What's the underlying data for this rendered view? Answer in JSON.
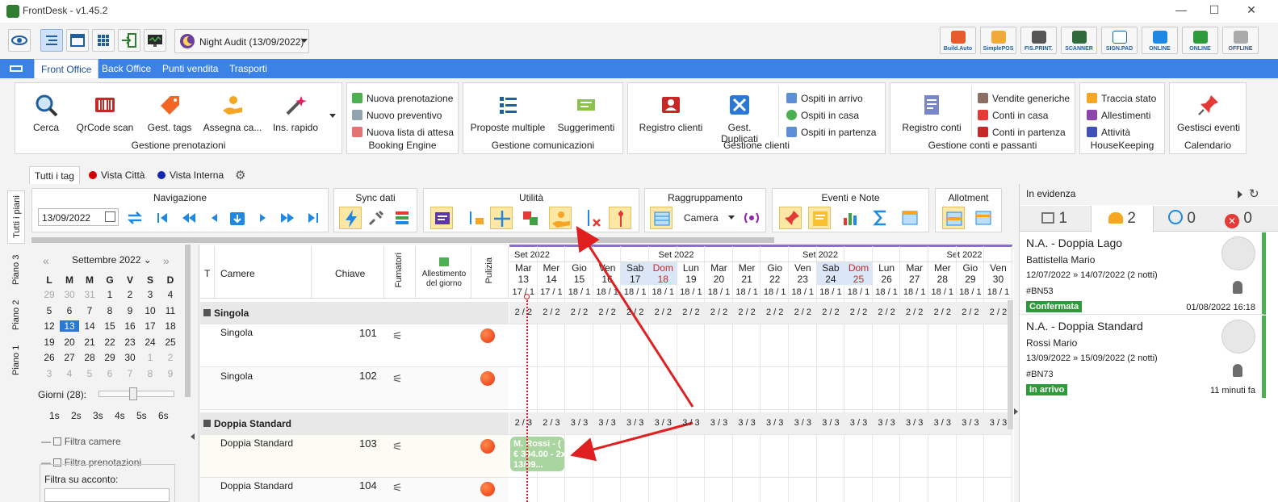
{
  "window": {
    "title": "FrontDesk - v1.45.2"
  },
  "toolbar": {
    "night_audit": "Night Audit (13/09/2022)",
    "right_buttons": [
      "Build.Auto",
      "SimplePOS",
      "FIS.PRINT.",
      "SCANNER",
      "SIGN.PAD",
      "ONLINE",
      "ONLINE",
      "OFFLINE"
    ]
  },
  "menu": [
    "Front Office",
    "Back Office",
    "Punti vendita",
    "Trasporti"
  ],
  "ribbon": {
    "gestione_prenotazioni": {
      "title": "Gestione prenotazioni",
      "buttons": [
        "Cerca",
        "QrCode scan",
        "Gest. tags",
        "Assegna ca...",
        "Ins. rapido"
      ]
    },
    "booking_engine": {
      "title": "Booking Engine",
      "buttons": [
        "Nuova prenotazione",
        "Nuovo preventivo",
        "Nuova lista di attesa"
      ]
    },
    "gestione_comunicazioni": {
      "title": "Gestione comunicazioni",
      "buttons": [
        "Proposte multiple",
        "Suggerimenti"
      ]
    },
    "gestione_clienti": {
      "title": "Gestione clienti",
      "buttons": [
        "Registro clienti",
        "Gest. Duplicati"
      ],
      "small": [
        "Ospiti in arrivo",
        "Ospiti in casa",
        "Ospiti in partenza"
      ]
    },
    "gestione_conti": {
      "title": "Gestione conti e passanti",
      "buttons": [
        "Registro conti"
      ],
      "small": [
        "Vendite generiche",
        "Conti in casa",
        "Conti in partenza"
      ]
    },
    "housekeeping": {
      "title": "HouseKeeping",
      "small": [
        "Traccia stato",
        "Allestimenti",
        "Attività"
      ]
    },
    "calendario": {
      "title": "Calendario",
      "buttons": [
        "Gestisci eventi"
      ]
    }
  },
  "view_tabs": [
    "Tutti i tag",
    "Vista Città",
    "Vista Interna"
  ],
  "floor_tabs": [
    "Tutti i piani",
    "Piano 3",
    "Piano 2",
    "Piano 1"
  ],
  "nav": {
    "navigazione": "Navigazione",
    "date": "13/09/2022",
    "sync": "Sync dati",
    "utilita": "Utilità",
    "raggruppamento": "Raggruppamento",
    "raggruppamento_value": "Camera",
    "eventi": "Eventi e Note",
    "allotment": "Allotment"
  },
  "calendar": {
    "month": "Settembre 2022",
    "weekdays": [
      "L",
      "M",
      "M",
      "G",
      "V",
      "S",
      "D"
    ],
    "weeks": [
      [
        "29",
        "30",
        "31",
        "1",
        "2",
        "3",
        "4"
      ],
      [
        "5",
        "6",
        "7",
        "8",
        "9",
        "10",
        "11"
      ],
      [
        "12",
        "13",
        "14",
        "15",
        "16",
        "17",
        "18"
      ],
      [
        "19",
        "20",
        "21",
        "22",
        "23",
        "24",
        "25"
      ],
      [
        "26",
        "27",
        "28",
        "29",
        "30",
        "1",
        "2"
      ],
      [
        "3",
        "4",
        "5",
        "6",
        "7",
        "8",
        "9"
      ]
    ],
    "selected": "13",
    "days_label": "Giorni (28):",
    "presets": [
      "1s",
      "2s",
      "3s",
      "4s",
      "5s",
      "6s"
    ],
    "filtra_camere": "Filtra camere",
    "filtra_prenotazioni": "Filtra prenotazioni",
    "filtra_acconto": "Filtra su acconto:"
  },
  "grid": {
    "headers": {
      "t": "T",
      "camere": "Camere",
      "chiave": "Chiave",
      "fumatori": "Fumatori",
      "allestimento": "Allestimento del giorno",
      "pulizia": "Pulizia"
    },
    "months": [
      "Set 2022",
      "Set 2022",
      "Set 2022",
      "Set 2022"
    ],
    "days": [
      {
        "d": "Mar",
        "n": "13",
        "o": "17 / 1",
        "g1": "2 / 2",
        "g2": "2 / 3"
      },
      {
        "d": "Mer",
        "n": "14",
        "o": "17 / 1",
        "g1": "2 / 2",
        "g2": "2 / 3"
      },
      {
        "d": "Gio",
        "n": "15",
        "o": "18 / 1",
        "g1": "2 / 2",
        "g2": "3 / 3"
      },
      {
        "d": "Ven",
        "n": "16",
        "o": "18 / 1",
        "g1": "2 / 2",
        "g2": "3 / 3"
      },
      {
        "d": "Sab",
        "n": "17",
        "o": "18 / 1",
        "g1": "2 / 2",
        "g2": "3 / 3"
      },
      {
        "d": "Dom",
        "n": "18",
        "o": "18 / 1",
        "g1": "2 / 2",
        "g2": "3 / 3"
      },
      {
        "d": "Lun",
        "n": "19",
        "o": "18 / 1",
        "g1": "2 / 2",
        "g2": "3 / 3"
      },
      {
        "d": "Mar",
        "n": "20",
        "o": "18 / 1",
        "g1": "2 / 2",
        "g2": "3 / 3"
      },
      {
        "d": "Mer",
        "n": "21",
        "o": "18 / 1",
        "g1": "2 / 2",
        "g2": "3 / 3"
      },
      {
        "d": "Gio",
        "n": "22",
        "o": "18 / 1",
        "g1": "2 / 2",
        "g2": "3 / 3"
      },
      {
        "d": "Ven",
        "n": "23",
        "o": "18 / 1",
        "g1": "2 / 2",
        "g2": "3 / 3"
      },
      {
        "d": "Sab",
        "n": "24",
        "o": "18 / 1",
        "g1": "2 / 2",
        "g2": "3 / 3"
      },
      {
        "d": "Dom",
        "n": "25",
        "o": "18 / 1",
        "g1": "2 / 2",
        "g2": "3 / 3"
      },
      {
        "d": "Lun",
        "n": "26",
        "o": "18 / 1",
        "g1": "2 / 2",
        "g2": "3 / 3"
      },
      {
        "d": "Mar",
        "n": "27",
        "o": "18 / 1",
        "g1": "2 / 2",
        "g2": "3 / 3"
      },
      {
        "d": "Mer",
        "n": "28",
        "o": "18 / 1",
        "g1": "2 / 2",
        "g2": "3 / 3"
      },
      {
        "d": "Gio",
        "n": "29",
        "o": "18 / 1",
        "g1": "2 / 2",
        "g2": "3 / 3"
      },
      {
        "d": "Ven",
        "n": "30",
        "o": "18 / 1",
        "g1": "2 / 2",
        "g2": "3 / 3"
      }
    ],
    "groups": [
      "Singola",
      "Doppia Standard"
    ],
    "rooms": [
      {
        "name": "Singola",
        "key": "101"
      },
      {
        "name": "Singola",
        "key": "102"
      },
      {
        "name": "Doppia Standard",
        "key": "103"
      },
      {
        "name": "Doppia Standard",
        "key": "104"
      }
    ],
    "booking": {
      "line1": "M. Rossi - (",
      "line2": "€ 304.00 - 2x",
      "line3": "13/09..."
    }
  },
  "panel": {
    "title": "In evidenza",
    "tabs": [
      "1",
      "2",
      "0",
      "0"
    ],
    "cards": [
      {
        "title": "N.A. - Doppia Lago",
        "guest": "Battistella Mario",
        "dates": "12/07/2022 » 14/07/2022 (2 notti)",
        "code": "#BN53",
        "status": "Confermata",
        "time": "01/08/2022 16:18"
      },
      {
        "title": "N.A. - Doppia Standard",
        "guest": "Rossi Mario",
        "dates": "13/09/2022 » 15/09/2022 (2 notti)",
        "code": "#BN73",
        "status": "In arrivo",
        "time": "11 minuti fa"
      }
    ]
  },
  "colors": {
    "accent": "#3c82e6",
    "menu_active": "#1b4f9a",
    "status_green": "#2e9b3a",
    "arrow_red": "#e02020"
  }
}
